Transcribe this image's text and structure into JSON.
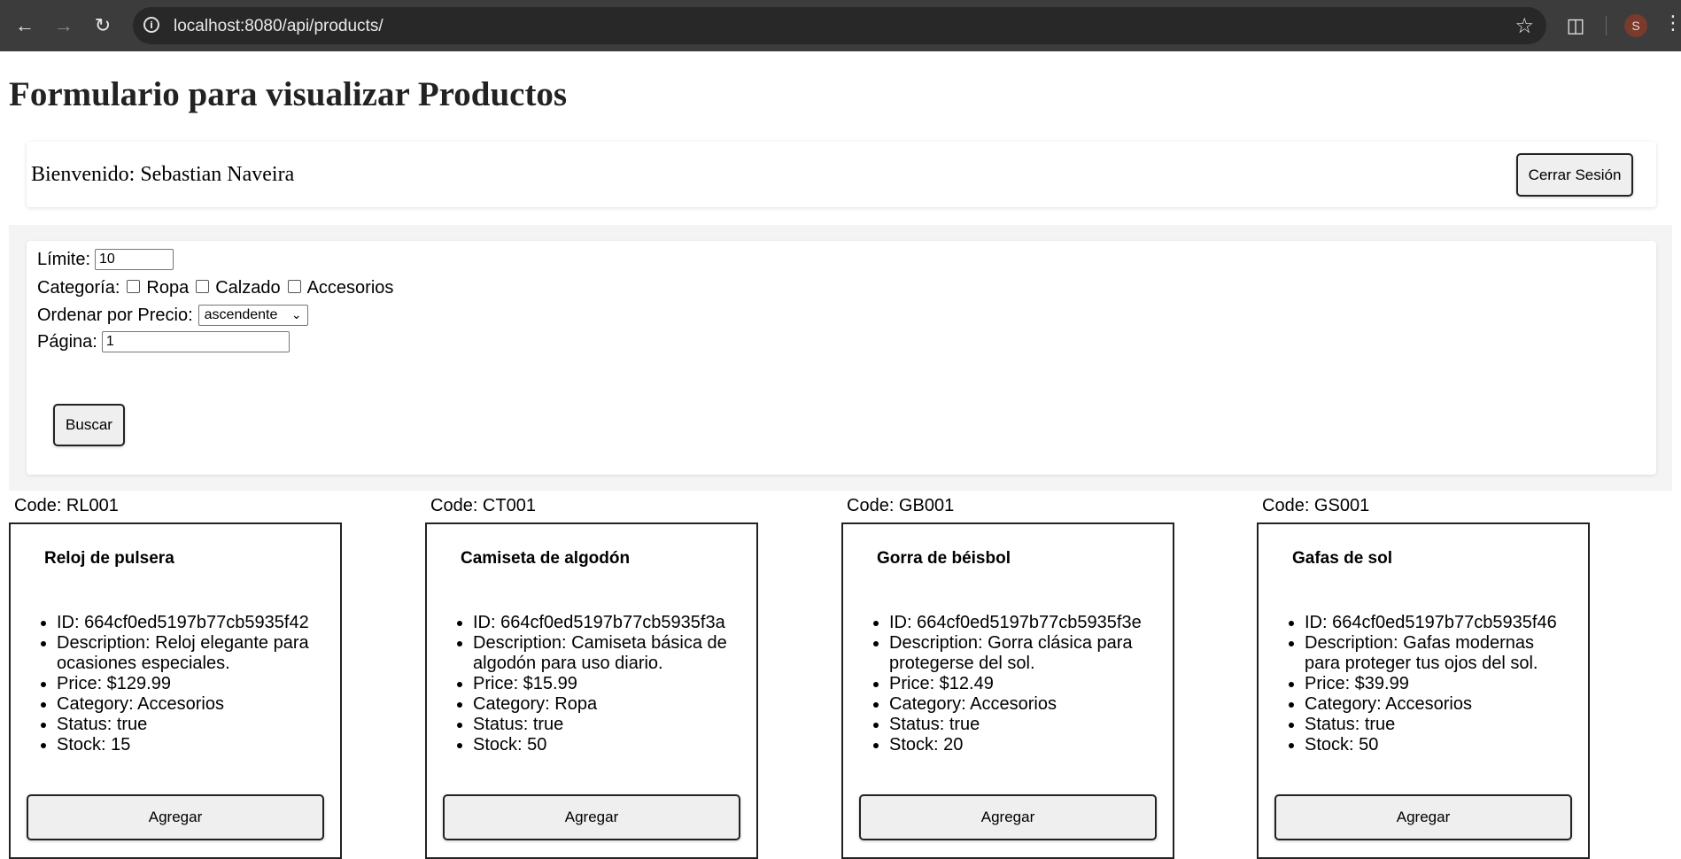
{
  "browser": {
    "url": "localhost:8080/api/products/",
    "profile_initial": "S"
  },
  "page": {
    "title": "Formulario para visualizar Productos",
    "welcome": "Bienvenido: Sebastian Naveira",
    "logout_label": "Cerrar Sesión"
  },
  "filters": {
    "limit_label": "Límite:",
    "limit_value": "10",
    "category_label": "Categoría:",
    "categories": [
      "Ropa",
      "Calzado",
      "Accesorios"
    ],
    "sort_label": "Ordenar por Precio:",
    "sort_value": "ascendente",
    "page_label": "Página:",
    "page_value": "1",
    "search_label": "Buscar"
  },
  "products": [
    {
      "code": "Code: RL001",
      "name": "Reloj de pulsera",
      "id": "ID: 664cf0ed5197b77cb5935f42",
      "description": "Description: Reloj elegante para ocasiones especiales.",
      "price": "Price: $129.99",
      "category": "Category: Accesorios",
      "status": "Status: true",
      "stock": "Stock: 15",
      "button": "Agregar"
    },
    {
      "code": "Code: CT001",
      "name": "Camiseta de algodón",
      "id": "ID: 664cf0ed5197b77cb5935f3a",
      "description": "Description: Camiseta básica de algodón para uso diario.",
      "price": "Price: $15.99",
      "category": "Category: Ropa",
      "status": "Status: true",
      "stock": "Stock: 50",
      "button": "Agregar"
    },
    {
      "code": "Code: GB001",
      "name": "Gorra de béisbol",
      "id": "ID: 664cf0ed5197b77cb5935f3e",
      "description": "Description: Gorra clásica para protegerse del sol.",
      "price": "Price: $12.49",
      "category": "Category: Accesorios",
      "status": "Status: true",
      "stock": "Stock: 20",
      "button": "Agregar"
    },
    {
      "code": "Code: GS001",
      "name": "Gafas de sol",
      "id": "ID: 664cf0ed5197b77cb5935f46",
      "description": "Description: Gafas modernas para proteger tus ojos del sol.",
      "price": "Price: $39.99",
      "category": "Category: Accesorios",
      "status": "Status: true",
      "stock": "Stock: 50",
      "button": "Agregar"
    }
  ]
}
